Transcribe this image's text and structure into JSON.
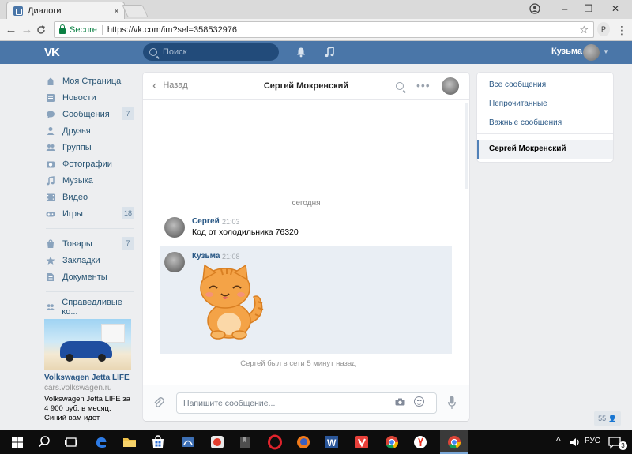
{
  "browser": {
    "tab_title": "Диалоги",
    "tab_close": "×",
    "window_minimize": "–",
    "window_maximize": "❐",
    "window_close": "✕",
    "back": "←",
    "forward": "→",
    "reload": "C",
    "secure_label": "Secure",
    "url": "https://vk.com/im?sel=358532976",
    "star": "☆",
    "extension_label": "P",
    "menu": "⋮"
  },
  "header": {
    "logo": "VK",
    "search_placeholder": "Поиск",
    "user_name": "Кузьма",
    "caret": "▼"
  },
  "leftmenu": {
    "items": [
      {
        "label": "Моя Страница",
        "icon": "home-icon"
      },
      {
        "label": "Новости",
        "icon": "news-icon"
      },
      {
        "label": "Сообщения",
        "icon": "messages-icon",
        "count": "7"
      },
      {
        "label": "Друзья",
        "icon": "friends-icon"
      },
      {
        "label": "Группы",
        "icon": "groups-icon"
      },
      {
        "label": "Фотографии",
        "icon": "photos-icon"
      },
      {
        "label": "Музыка",
        "icon": "music-icon"
      },
      {
        "label": "Видео",
        "icon": "video-icon"
      },
      {
        "label": "Игры",
        "icon": "games-icon",
        "count": "18"
      }
    ],
    "items2": [
      {
        "label": "Товары",
        "icon": "goods-icon",
        "count": "7"
      },
      {
        "label": "Закладки",
        "icon": "bookmarks-icon"
      },
      {
        "label": "Документы",
        "icon": "documents-icon"
      }
    ],
    "items3": [
      {
        "label": "Справедливые ко...",
        "icon": "community-icon"
      }
    ]
  },
  "ad": {
    "title": "Volkswagen Jetta LIFE",
    "domain": "cars.volkswagen.ru",
    "text": "Volkswagen Jetta LIFE за 4 900 руб. в месяц. Синий вам идет"
  },
  "chat": {
    "back_label": "Назад",
    "title": "Сергей Мокренский",
    "more": "•••",
    "date_separator": "сегодня",
    "messages": [
      {
        "author": "Сергей",
        "time": "21:03",
        "text": "Код от холодильника 76320"
      },
      {
        "author": "Кузьма",
        "time": "21:08",
        "text": ""
      }
    ],
    "status": "Сергей был в сети 5 минут назад",
    "input_placeholder": "Напишите сообщение..."
  },
  "rightpanel": {
    "items": [
      "Все сообщения",
      "Непрочитанные",
      "Важные сообщения"
    ],
    "active": "Сергей Мокренский"
  },
  "online_count": "55",
  "taskbar": {
    "language": "РУС",
    "caret": "^",
    "notifications": "3"
  },
  "colors": {
    "vk_blue": "#4a76a8",
    "link": "#2a5885",
    "background": "#edeef0"
  }
}
